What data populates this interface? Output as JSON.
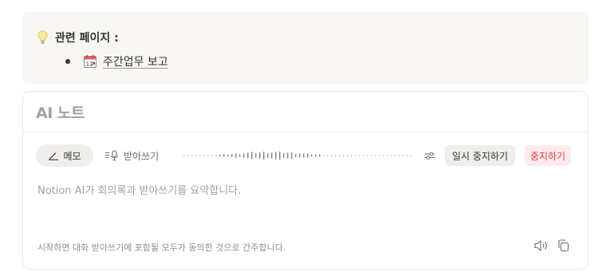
{
  "callout": {
    "icon": "lightbulb-icon",
    "title": "관련 페이지 :",
    "items": [
      {
        "icon": "calendar-page-icon",
        "label": "주간업무 보고"
      }
    ]
  },
  "ai_notes": {
    "title": "AI 노트",
    "tabs": {
      "memo": {
        "icon": "pencil-icon",
        "label": "메모"
      },
      "transcript": {
        "icon": "transcript-icon",
        "label": "받아쓰기"
      }
    },
    "controls": {
      "settings_icon": "sliders-icon",
      "pause_label": "일시 중지하기",
      "stop_label": "중지하기"
    },
    "hint": "Notion AI가 회의록과 받아쓰기를 요약합니다.",
    "consent": "시작하면 대화 받아쓰기에 포함될 모두가 동의한 것으로 간주합니다.",
    "footer_icons": [
      "speaker-icon",
      "copy-icon"
    ]
  },
  "colors": {
    "callout_bg": "#f7f6f3",
    "stop_text": "#e03e3e",
    "stop_bg": "#fdebec",
    "muted_text": "#a3a29e"
  }
}
